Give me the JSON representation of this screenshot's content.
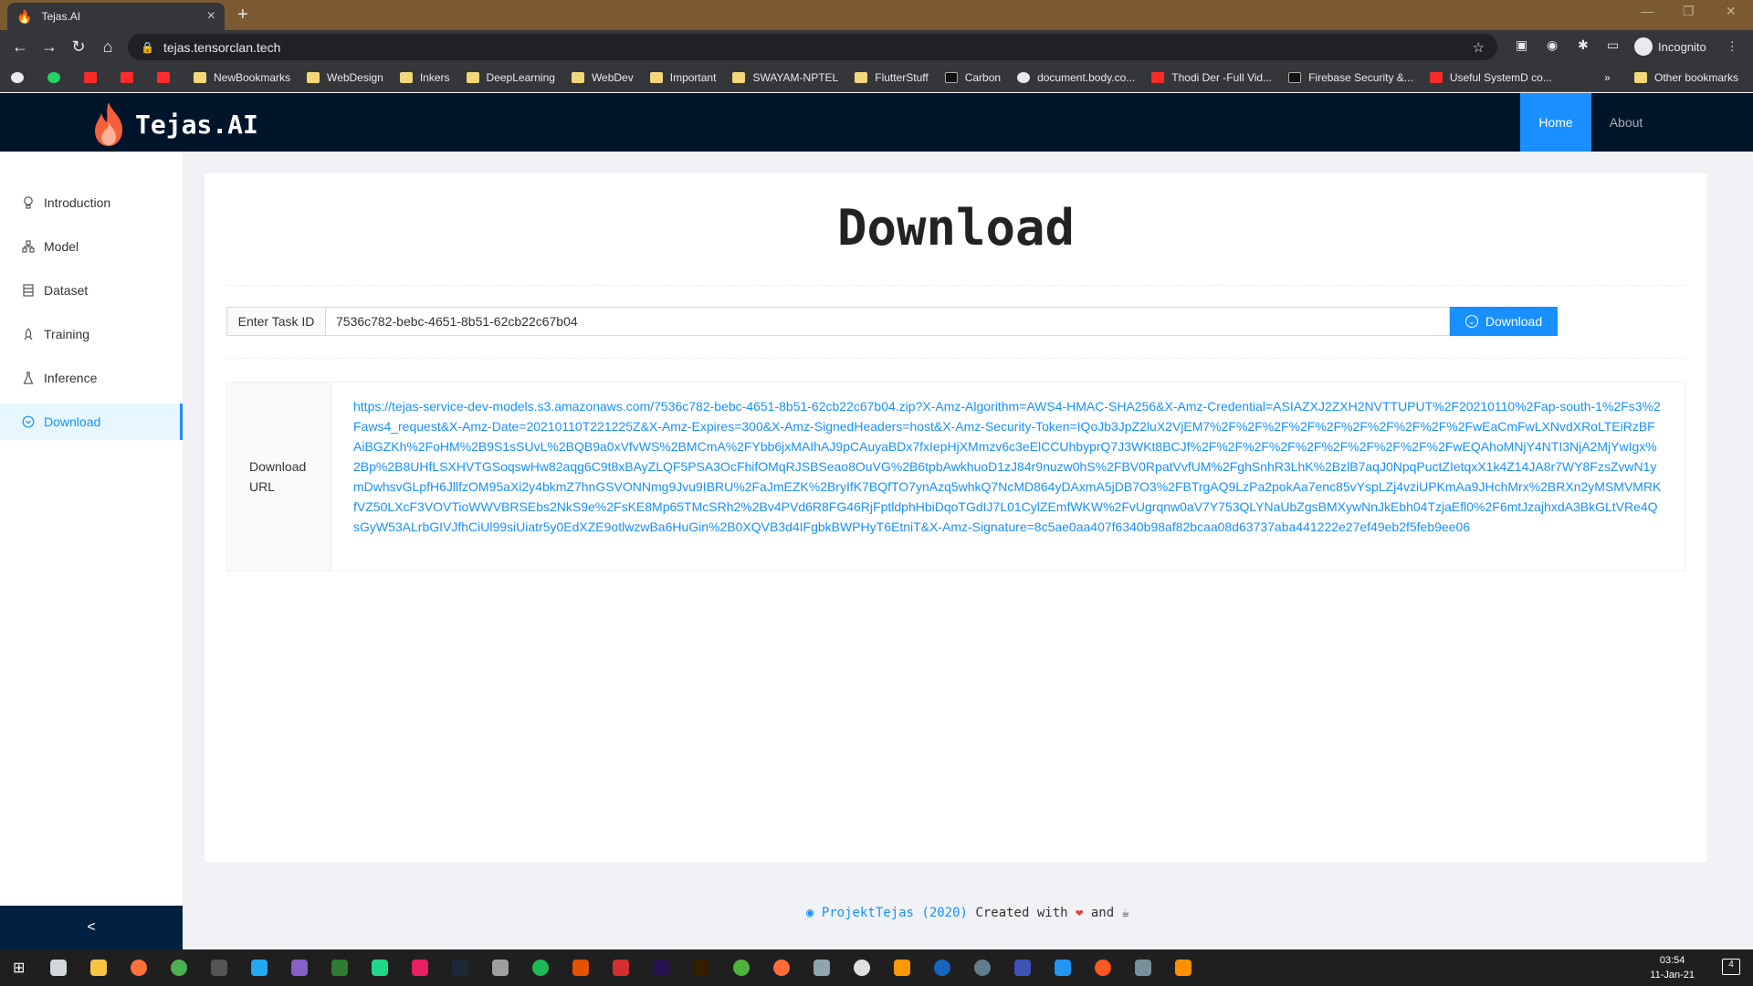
{
  "browser": {
    "tab_title": "Tejas.AI",
    "url": "tejas.tensorclan.tech",
    "profile": "Incognito",
    "bookmarks": [
      "NewBookmarks",
      "WebDesign",
      "Inkers",
      "DeepLearning",
      "WebDev",
      "Important",
      "SWAYAM-NPTEL",
      "FlutterStuff",
      "Carbon",
      "document.body.co...",
      "Thodi Der -Full Vid...",
      "Firebase Security &...",
      "Useful SystemD co..."
    ],
    "other_bookmarks": "Other bookmarks",
    "overflow": "»"
  },
  "app": {
    "brand": "Tejas.AI",
    "nav": {
      "home": "Home",
      "about": "About"
    },
    "sidebar": [
      {
        "label": "Introduction",
        "icon": "bulb-icon"
      },
      {
        "label": "Model",
        "icon": "cluster-icon"
      },
      {
        "label": "Dataset",
        "icon": "database-icon"
      },
      {
        "label": "Training",
        "icon": "rocket-icon"
      },
      {
        "label": "Inference",
        "icon": "experiment-icon"
      },
      {
        "label": "Download",
        "icon": "download-circle-icon"
      }
    ],
    "collapse_glyph": "<",
    "colors": {
      "header": "#001529",
      "accent": "#1890ff"
    }
  },
  "page": {
    "title": "Download",
    "task_label": "Enter Task ID",
    "task_value": "7536c782-bebc-4651-8b51-62cb22c67b04",
    "download_button": "Download",
    "url_label": "Download URL",
    "download_url": "https://tejas-service-dev-models.s3.amazonaws.com/7536c782-bebc-4651-8b51-62cb22c67b04.zip?X-Amz-Algorithm=AWS4-HMAC-SHA256&X-Amz-Credential=ASIAZXJ2ZXH2NVTTUPUT%2F20210110%2Fap-south-1%2Fs3%2Faws4_request&X-Amz-Date=20210110T221225Z&X-Amz-Expires=300&X-Amz-SignedHeaders=host&X-Amz-Security-Token=IQoJb3JpZ2luX2VjEM7%2F%2F%2F%2F%2F%2F%2F%2F%2F%2FwEaCmFwLXNvdXRoLTEiRzBFAiBGZKh%2FoHM%2B9S1sSUvL%2BQB9a0xVfvWS%2BMCmA%2FYbb6jxMAIhAJ9pCAuyaBDx7fxIepHjXMmzv6c3eElCCUhbyprQ7J3WKt8BCJf%2F%2F%2F%2F%2F%2F%2F%2F%2F%2FwEQAhoMNjY4NTI3NjA2MjYwIgx%2Bp%2B8UHfLSXHVTGSoqswHw82aqg6C9t8xBAyZLQF5PSA3OcFhifOMqRJSBSeao8OuVG%2B6tpbAwkhuoD1zJ84r9nuzw0hS%2FBV0RpatVvfUM%2FghSnhR3LhK%2BzlB7aqJ0NpqPuctZIetqxX1k4Z14JA8r7WY8FzsZvwN1ymDwhsvGLpfH6JllfzOM95aXi2y4bkmZ7hnGSVONNmg9Jvu9IBRU%2FaJmEZK%2BryIfK7BQfTO7ynAzq5whkQ7NcMD864yDAxmA5jDB7O3%2FBTrgAQ9LzPa2pokAa7enc85vYspLZj4vziUPKmAa9JHchMrx%2BRXn2yMSMVMRKfVZ50LXcF3VOVTioWWVBRSEbs2NkS9e%2FsKE8Mp65TMcSRh2%2Bv4PVd6R8FG46RjFptldphHbiDqoTGdIJ7L01CylZEmfWKW%2FvUgrqnw0aV7Y753QLYNaUbZgsBMXywNnJkEbh04TzjaEfl0%2F6mtJzajhxdA3BkGLtVRe4QsGyW53ALrbGIVJfhCiUl99siUiatr5y0EdXZE9otlwzwBa6HuGin%2B0XQVB3d4IFgbkBWPHyT6EtniT&X-Amz-Signature=8c5ae0aa407f6340b98af82bcaa08d63737aba441222e27ef49eb2f5feb9ee06"
  },
  "footer": {
    "project": "ProjektTejas (2020)",
    "created": "Created with",
    "and": "and"
  },
  "taskbar": {
    "time": "03:54",
    "date": "11-Jan-21",
    "notifications": "4"
  }
}
